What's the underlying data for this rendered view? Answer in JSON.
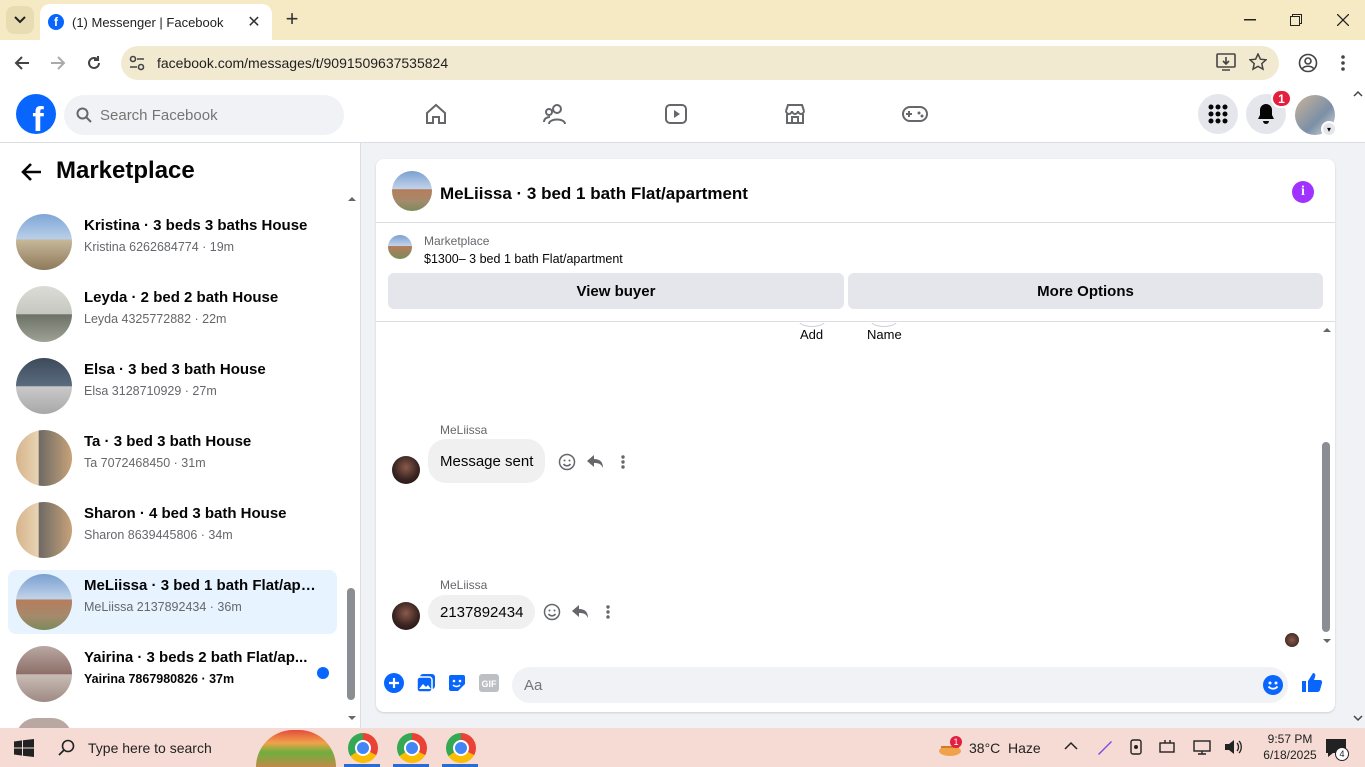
{
  "browser": {
    "tab_title": "(1) Messenger | Facebook",
    "url": "facebook.com/messages/t/9091509637535824"
  },
  "fb": {
    "search_placeholder": "Search Facebook",
    "notification_count": "1",
    "brand_color": "#0866ff"
  },
  "marketplace": {
    "title": "Marketplace",
    "conversations": [
      {
        "title": "Kristina · 3 beds 3 baths House",
        "sub": "Kristina 6262684774 · 19m",
        "unread": false
      },
      {
        "title": "Leyda · 2 bed 2 bath House",
        "sub": "Leyda 4325772882 · 22m",
        "unread": false
      },
      {
        "title": "Elsa · 3 bed 3 bath House",
        "sub": "Elsa 3128710929 · 27m",
        "unread": false
      },
      {
        "title": "Ta · 3 bed 3 bath House",
        "sub": "Ta 7072468450 · 31m",
        "unread": false
      },
      {
        "title": "Sharon · 4 bed 3 bath House",
        "sub": "Sharon 8639445806 · 34m",
        "unread": false
      },
      {
        "title": "MeLiissa · 3 bed 1 bath Flat/apar...",
        "sub": "MeLiissa 2137892434 · 36m",
        "unread": false
      },
      {
        "title": "Yairina · 3 beds 2 bath Flat/ap...",
        "sub": "Yairina 7867980826 · 37m",
        "unread": true
      }
    ]
  },
  "chat": {
    "title": "MeLiissa · 3 bed 1 bath Flat/apartment",
    "listing_label": "Marketplace",
    "listing_price": "$1300– 3 bed 1 bath Flat/apartment",
    "view_buyer": "View buyer",
    "more_options": "More Options",
    "top_actions": [
      "Add",
      "Name"
    ],
    "messages": [
      {
        "sender": "MeLiissa",
        "text": "Message sent"
      },
      {
        "sender": "MeLiissa",
        "text": "2137892434"
      }
    ],
    "composer_placeholder": "Aa"
  },
  "taskbar": {
    "search_placeholder": "Type here to search",
    "weather_temp": "38°C",
    "weather_desc": "Haze",
    "weather_badge": "1",
    "time": "9:57 PM",
    "date": "6/18/2025",
    "notif_count": "4"
  }
}
